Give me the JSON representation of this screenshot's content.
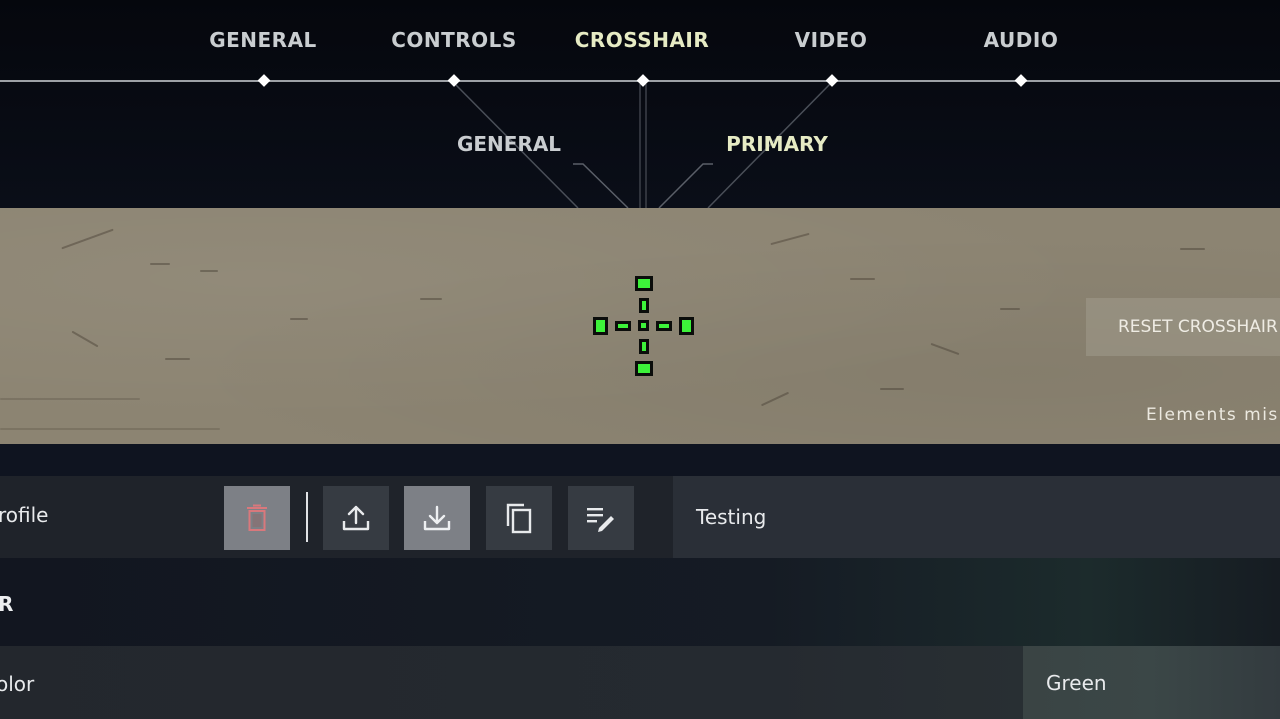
{
  "nav": {
    "tabs": [
      {
        "label": "GENERAL",
        "active": false
      },
      {
        "label": "CONTROLS",
        "active": false
      },
      {
        "label": "CROSSHAIR",
        "active": true
      },
      {
        "label": "VIDEO",
        "active": false
      },
      {
        "label": "AUDIO",
        "active": false
      }
    ]
  },
  "subnav": {
    "tabs": [
      {
        "label": "GENERAL",
        "active": false
      },
      {
        "label": "PRIMARY",
        "active": true
      }
    ]
  },
  "preview": {
    "reset_label": "RESET CROSSHAIR",
    "note": "Elements mis",
    "crosshair_color": "#3df23a",
    "crosshair_outline": "#0b0d0b"
  },
  "profile": {
    "label": "rofile",
    "buttons": [
      {
        "name": "delete-profile-button",
        "icon": "trash-icon"
      },
      {
        "name": "export-profile-button",
        "icon": "upload-icon"
      },
      {
        "name": "import-profile-button",
        "icon": "download-icon"
      },
      {
        "name": "copy-profile-button",
        "icon": "copy-icon"
      },
      {
        "name": "rename-profile-button",
        "icon": "edit-list-icon"
      }
    ],
    "current_value": "Testing"
  },
  "section": {
    "title": "R"
  },
  "color_setting": {
    "label": "olor",
    "value": "Green"
  },
  "colors": {
    "accent_active": "#e6ebc4",
    "delete_icon": "#d9787c"
  }
}
